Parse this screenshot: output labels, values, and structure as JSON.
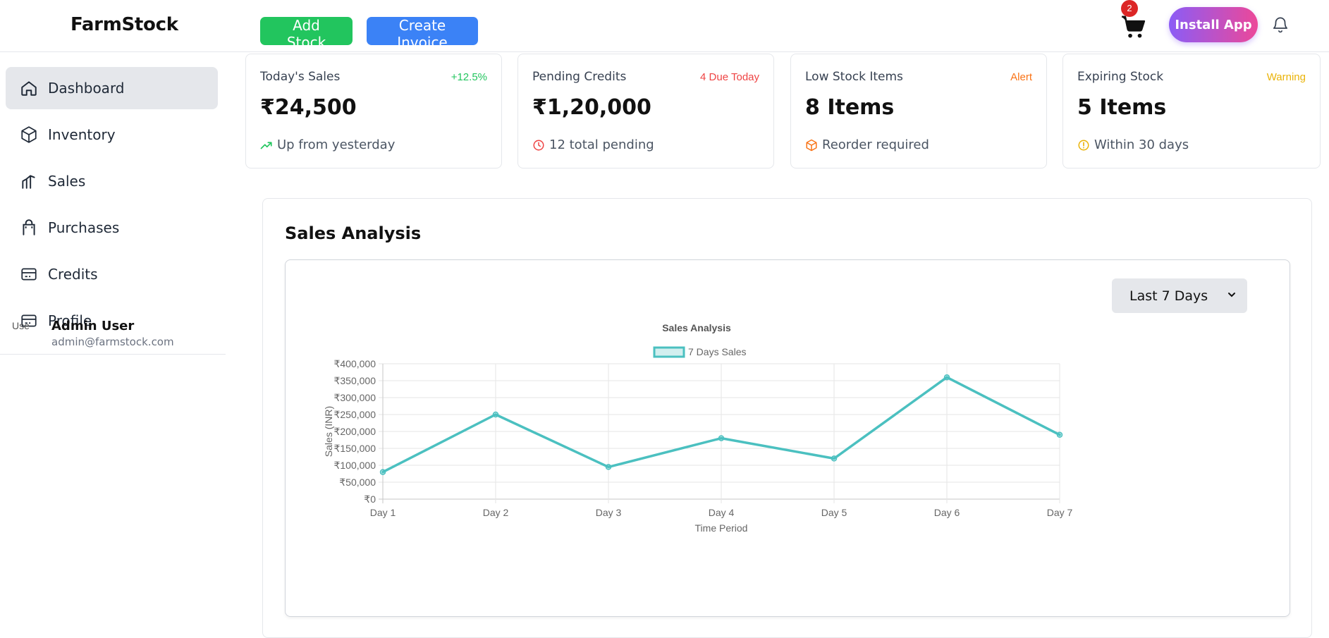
{
  "header": {
    "brand": "FarmStock",
    "add_stock": "Add Stock",
    "create_invoice": "Create Invoice",
    "cart_count": "2",
    "install_app": "Install App"
  },
  "sidebar": {
    "items": [
      {
        "label": "Dashboard",
        "icon": "home-icon",
        "active": true
      },
      {
        "label": "Inventory",
        "icon": "box-icon"
      },
      {
        "label": "Sales",
        "icon": "bar-chart-icon"
      },
      {
        "label": "Purchases",
        "icon": "shopping-bag-icon"
      },
      {
        "label": "Credits",
        "icon": "credit-card-icon"
      },
      {
        "label": "Profile",
        "icon": "credit-card-icon"
      }
    ],
    "user": {
      "avatar_alt": "Use",
      "name": "Admin User",
      "email": "admin@farmstock.com"
    }
  },
  "cards": [
    {
      "title": "Today's Sales",
      "tag": "+12.5%",
      "tag_color": "#22c55e",
      "value": "₹24,500",
      "foot": "Up from yesterday",
      "foot_icon": "trending-up-icon",
      "icon_color": "#22c55e"
    },
    {
      "title": "Pending Credits",
      "tag": "4 Due Today",
      "tag_color": "#ef4444",
      "value": "₹1,20,000",
      "foot": "12 total pending",
      "foot_icon": "clock-icon",
      "icon_color": "#ef4444"
    },
    {
      "title": "Low Stock Items",
      "tag": "Alert",
      "tag_color": "#f97316",
      "value": "8 Items",
      "foot": "Reorder required",
      "foot_icon": "box-icon",
      "icon_color": "#f97316"
    },
    {
      "title": "Expiring Stock",
      "tag": "Warning",
      "tag_color": "#eab308",
      "value": "5 Items",
      "foot": "Within 30 days",
      "foot_icon": "alert-circle-icon",
      "icon_color": "#eab308"
    }
  ],
  "analysis": {
    "title": "Sales Analysis",
    "period_select": "Last 7 Days"
  },
  "chart_data": {
    "type": "line",
    "title": "Sales Analysis",
    "xlabel": "Time Period",
    "ylabel": "Sales (INR)",
    "categories": [
      "Day 1",
      "Day 2",
      "Day 3",
      "Day 4",
      "Day 5",
      "Day 6",
      "Day 7"
    ],
    "series": [
      {
        "name": "7 Days Sales",
        "values": [
          80000,
          250000,
          95000,
          180000,
          120000,
          360000,
          190000
        ],
        "color": "#4bc0c0"
      }
    ],
    "ylim": [
      0,
      400000
    ],
    "yticks": [
      "₹0",
      "₹50,000",
      "₹100,000",
      "₹150,000",
      "₹200,000",
      "₹250,000",
      "₹300,000",
      "₹350,000",
      "₹400,000"
    ],
    "grid": true,
    "legend": "top"
  }
}
